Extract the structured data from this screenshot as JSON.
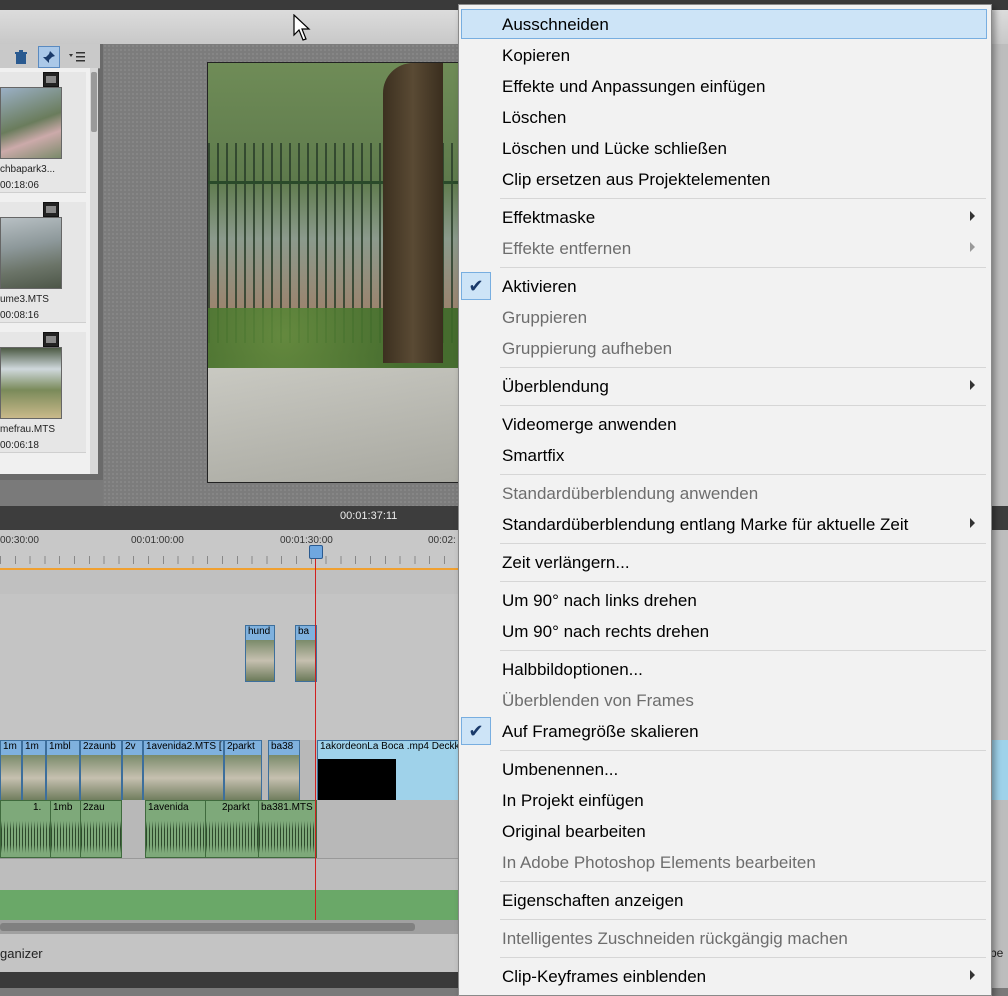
{
  "panel": {
    "media": [
      {
        "name": "chbapark3...",
        "duration": "00:18:06"
      },
      {
        "name": "ume3.MTS",
        "duration": "00:08:16"
      },
      {
        "name": "mefrau.MTS",
        "duration": "00:06:18"
      }
    ]
  },
  "timeline": {
    "current_time": "00:01:37:11",
    "ruler_labels": [
      "00:30:00",
      "00:01:00:00",
      "00:01:30:00",
      "00:02:"
    ],
    "overlay_clips": [
      "hund",
      "ba"
    ],
    "video_clips": [
      "1m",
      "1m",
      "1mbl",
      "2zaunb",
      "2v",
      "1avenida2.MTS [",
      "2parkt",
      "ba38",
      "1akordeonLa Boca .mp4 Deckk"
    ],
    "audio_clips": [
      "1.",
      "1mb",
      "2zau",
      "1avenida",
      "2parkt",
      "ba381.MTS"
    ],
    "status_left": "ganizer",
    "status_right": "rbe"
  },
  "menu": {
    "items": [
      {
        "label": "Ausschneiden",
        "highlighted": true
      },
      {
        "label": "Kopieren"
      },
      {
        "label": "Effekte und Anpassungen einfügen"
      },
      {
        "label": "Löschen"
      },
      {
        "label": "Löschen und Lücke schließen"
      },
      {
        "label": "Clip ersetzen aus Projektelementen"
      },
      {
        "label": "Effektmaske",
        "submenu": true
      },
      {
        "label": "Effekte entfernen",
        "submenu": true,
        "disabled": true
      },
      {
        "label": "Aktivieren",
        "checked": true
      },
      {
        "label": "Gruppieren",
        "disabled": true
      },
      {
        "label": "Gruppierung aufheben",
        "disabled": true
      },
      {
        "label": "Überblendung",
        "submenu": true
      },
      {
        "label": "Videomerge anwenden"
      },
      {
        "label": "Smartfix"
      },
      {
        "label": "Standardüberblendung anwenden",
        "disabled": true
      },
      {
        "label": "Standardüberblendung entlang Marke für aktuelle Zeit",
        "submenu": true
      },
      {
        "label": "Zeit verlängern..."
      },
      {
        "label": "Um 90° nach links drehen"
      },
      {
        "label": "Um 90° nach rechts drehen"
      },
      {
        "label": "Halbbildoptionen..."
      },
      {
        "label": "Überblenden von Frames",
        "disabled": true
      },
      {
        "label": "Auf Framegröße skalieren",
        "checked": true
      },
      {
        "label": "Umbenennen..."
      },
      {
        "label": "In Projekt einfügen"
      },
      {
        "label": "Original bearbeiten"
      },
      {
        "label": "In Adobe Photoshop Elements bearbeiten",
        "disabled": true
      },
      {
        "label": "Eigenschaften anzeigen"
      },
      {
        "label": "Intelligentes Zuschneiden rückgängig machen",
        "disabled": true
      },
      {
        "label": "Clip-Keyframes einblenden",
        "submenu": true
      }
    ]
  },
  "colors": {
    "menu_highlight": "#cde4f7",
    "menu_highlight_border": "#78aee0",
    "video_clip": "#7fb1de",
    "audio_clip": "#7ea97a",
    "playhead": "#d02020",
    "orange_marker_line": "#f0a030"
  }
}
